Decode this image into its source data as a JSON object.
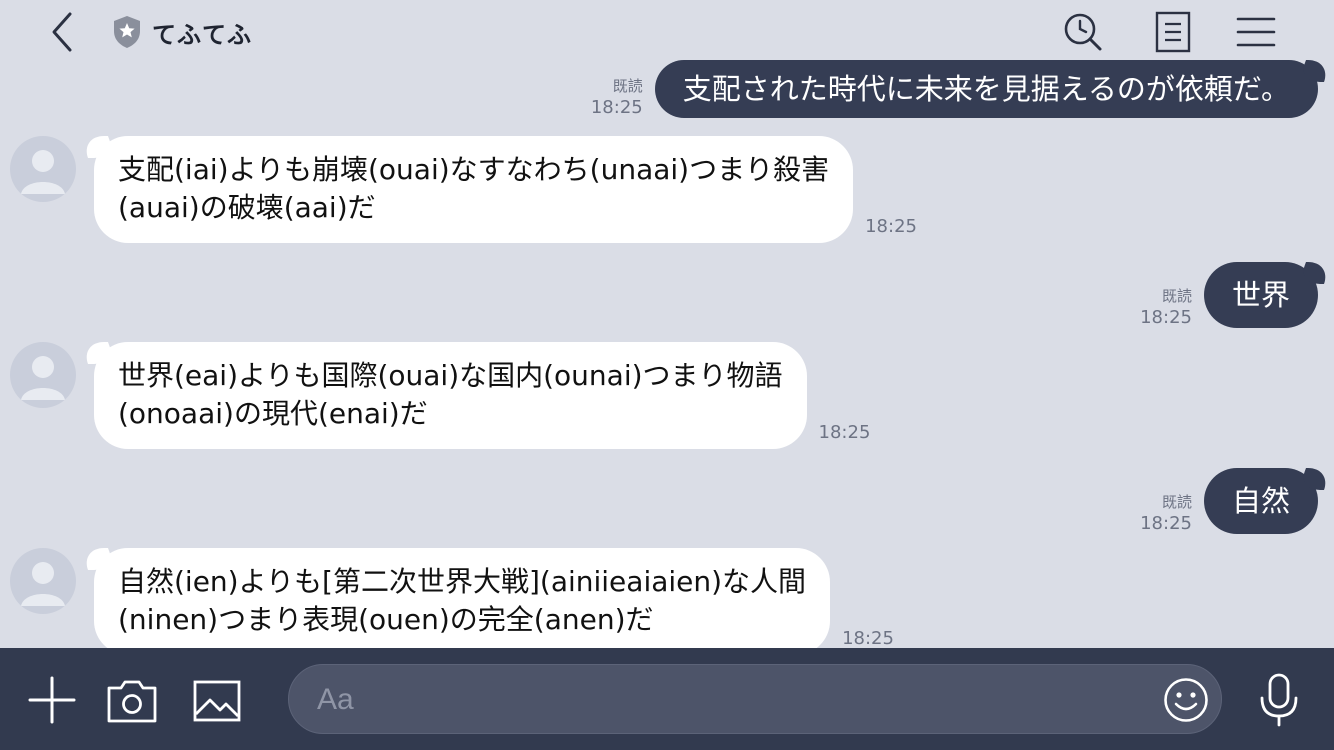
{
  "header": {
    "title": "てふてふ",
    "icons": [
      "back-icon",
      "shield-star-icon",
      "search-clock-icon",
      "note-icon",
      "menu-icon"
    ]
  },
  "messages": [
    {
      "dir": "out",
      "read": "既読",
      "time": "18:25",
      "text": "支配された時代に未来を見据えるのが依頼だ。"
    },
    {
      "dir": "in",
      "time": "18:25",
      "lines": [
        "支配(iai)よりも崩壊(ouai)なすなわち(unaai)つまり殺害",
        "(auai)の破壊(aai)だ"
      ]
    },
    {
      "dir": "out",
      "read": "既読",
      "time": "18:25",
      "text": "世界"
    },
    {
      "dir": "in",
      "time": "18:25",
      "lines": [
        "世界(eai)よりも国際(ouai)な国内(ounai)つまり物語",
        "(onoaai)の現代(enai)だ"
      ]
    },
    {
      "dir": "out",
      "read": "既読",
      "time": "18:25",
      "text": "自然"
    },
    {
      "dir": "in",
      "time": "18:25",
      "lines": [
        "自然(ien)よりも[第二次世界大戦](ainiieaiaien)な人間",
        "(ninen)つまり表現(ouen)の完全(anen)だ"
      ]
    }
  ],
  "composer": {
    "placeholder": "Aa",
    "icons": [
      "plus-icon",
      "camera-icon",
      "image-icon",
      "emoji-icon",
      "microphone-icon"
    ]
  },
  "colors": {
    "background": "#dadde6",
    "outgoing_bubble": "#353d54",
    "incoming_bubble": "#ffffff",
    "bottom_bar": "#323a4f",
    "input_field": "#4d5469"
  }
}
